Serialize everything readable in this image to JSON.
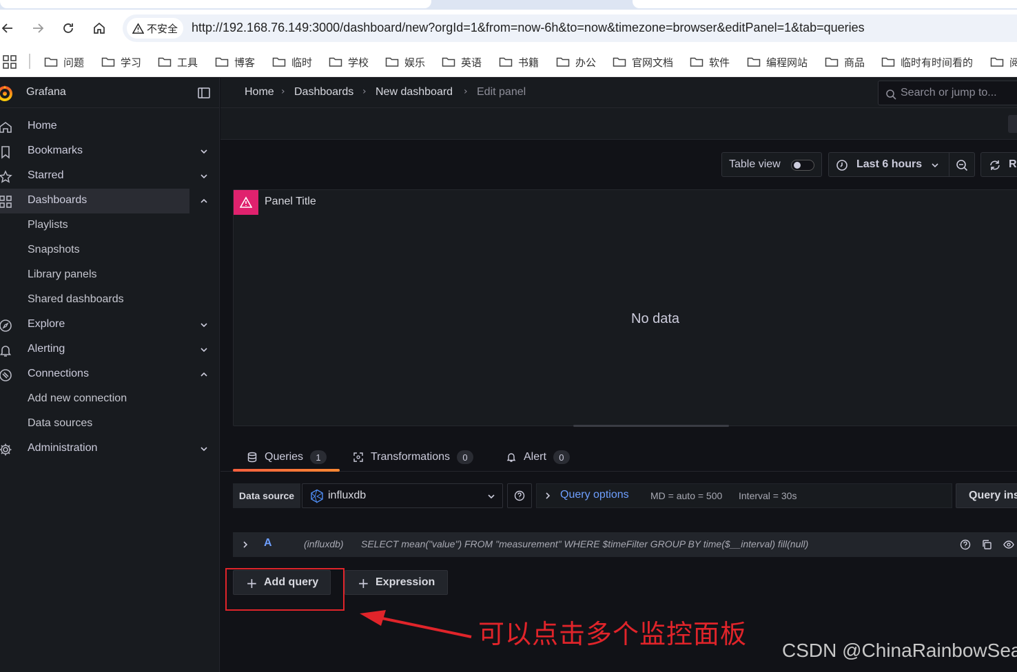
{
  "browser": {
    "insecure_label": "不安全",
    "url": "http://192.168.76.149:3000/dashboard/new?orgId=1&from=now-6h&to=now&timezone=browser&editPanel=1&tab=queries",
    "bookmarks": [
      "问题",
      "学习",
      "工具",
      "博客",
      "临时",
      "学校",
      "娱乐",
      "英语",
      "书籍",
      "办公",
      "官网文档",
      "软件",
      "编程网站",
      "商品",
      "临时有时间看的",
      "阅"
    ]
  },
  "app": {
    "brand": "Grafana",
    "nav": [
      {
        "label": "Home",
        "icon": "home-icon",
        "chevron": ""
      },
      {
        "label": "Bookmarks",
        "icon": "bookmark-icon",
        "chevron": "down"
      },
      {
        "label": "Starred",
        "icon": "star-icon",
        "chevron": "down"
      },
      {
        "label": "Dashboards",
        "icon": "apps-icon",
        "chevron": "up",
        "active": true
      },
      {
        "label": "Playlists",
        "sub": true
      },
      {
        "label": "Snapshots",
        "sub": true
      },
      {
        "label": "Library panels",
        "sub": true
      },
      {
        "label": "Shared dashboards",
        "sub": true
      },
      {
        "label": "Explore",
        "icon": "compass-icon",
        "chevron": "down"
      },
      {
        "label": "Alerting",
        "icon": "bell-icon",
        "chevron": "down"
      },
      {
        "label": "Connections",
        "icon": "plug-icon",
        "chevron": "up"
      },
      {
        "label": "Add new connection",
        "sub": true
      },
      {
        "label": "Data sources",
        "sub": true
      },
      {
        "label": "Administration",
        "icon": "cog-icon",
        "chevron": "down"
      }
    ],
    "breadcrumbs": [
      "Home",
      "Dashboards",
      "New dashboard",
      "Edit panel"
    ],
    "search_placeholder": "Search or jump to..."
  },
  "editor": {
    "table_view_label": "Table view",
    "time_range": "Last 6 hours",
    "refresh_label": "Re",
    "panel_title": "Panel Title",
    "no_data": "No data",
    "tabs": [
      {
        "label": "Queries",
        "count": "1",
        "icon": "database-icon"
      },
      {
        "label": "Transformations",
        "count": "0",
        "icon": "transform-icon"
      },
      {
        "label": "Alert",
        "count": "0",
        "icon": "bell-icon"
      }
    ],
    "datasource_label": "Data source",
    "datasource_value": "influxdb",
    "query_options_label": "Query options",
    "md_text": "MD = auto = 500",
    "interval_text": "Interval = 30s",
    "query_inspector_label": "Query ins",
    "query": {
      "ref": "A",
      "datasource": "(influxdb)",
      "sql": "SELECT mean(\"value\") FROM \"measurement\" WHERE $timeFilter GROUP BY time($__interval) fill(null)"
    },
    "add_query_label": "Add query",
    "expression_label": "Expression"
  },
  "annotation": {
    "text": "可以点击多个监控面板",
    "watermark": "CSDN @ChinaRainbowSea",
    "color": "#e0242a"
  }
}
